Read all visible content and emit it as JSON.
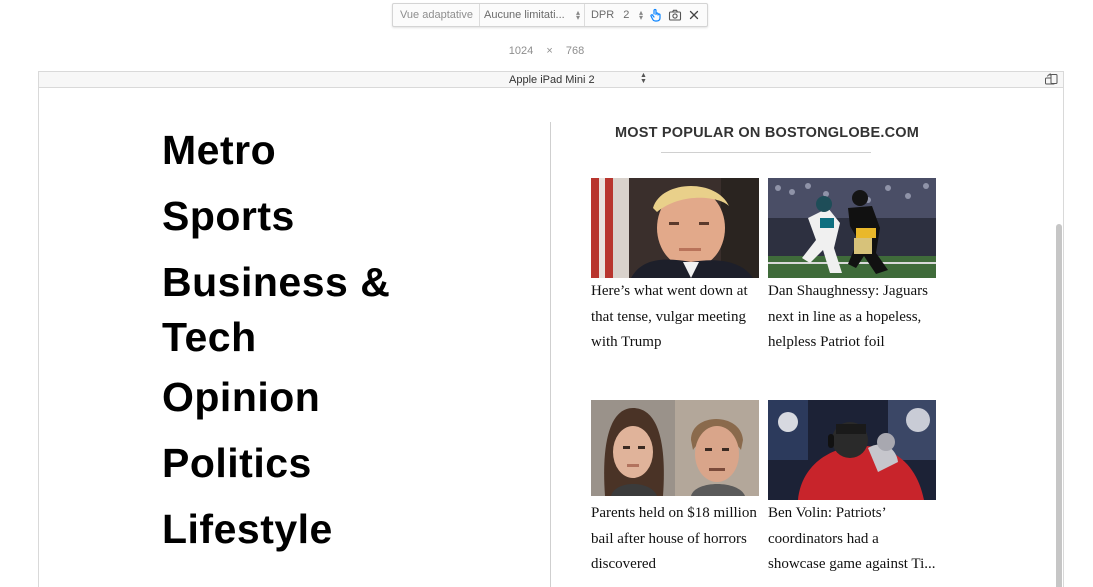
{
  "toolbar": {
    "viewport_label": "Vue adaptative",
    "throttle_label": "Aucune limitati...",
    "dpr_label": "DPR",
    "dpr_value": "2",
    "touch_icon": "touch-icon",
    "screenshot_icon": "camera-icon",
    "close_icon": "close-icon",
    "accent_color": "#0a84ff"
  },
  "dimensions": {
    "width": "1024",
    "separator": "×",
    "height": "768"
  },
  "device": {
    "name": "Apple iPad Mini 2",
    "rotate_icon": "rotate-device-icon"
  },
  "page": {
    "nav": [
      "Metro",
      "Sports",
      "Business & Tech",
      "Opinion",
      "Politics",
      "Lifestyle"
    ],
    "popular_title": "MOST POPULAR ON BOSTONGLOBE.COM",
    "stories": [
      {
        "headline": "Here’s what went down at that tense, vulgar meeting with Trump",
        "image": "trump-photo"
      },
      {
        "headline": "Dan Shaughnessy: Jaguars next in line as a hopeless, helpless Patriot foil",
        "image": "football-photo"
      },
      {
        "headline": "Parents held on $18 million bail after house of horrors discovered",
        "image": "mugshots-photo"
      },
      {
        "headline": "Ben Volin: Patriots’ coordinators had a showcase game against Ti...",
        "image": "patriots-coach-photo"
      }
    ]
  }
}
